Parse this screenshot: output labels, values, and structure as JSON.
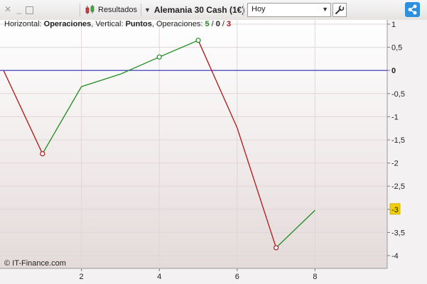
{
  "toolbar": {
    "results_label": "Resultados",
    "instrument_label": "Alemania 30 Cash (1€)",
    "period_value": "Hoy"
  },
  "legend": {
    "horizontal_prefix": "Horizontal: ",
    "horizontal_value": "Operaciones",
    "vertical_prefix": ", Vertical: ",
    "vertical_value": "Puntos",
    "operations_prefix": ", Operaciones: ",
    "wins": "5",
    "neutral": "0",
    "losses": "3",
    "slash": " / "
  },
  "copyright": "© IT-Finance.com",
  "colors": {
    "up": "#1c8a1c",
    "down": "#b01616",
    "zero_line": "#2a2ab8",
    "current_badge": "#f0d000"
  },
  "chart_data": {
    "type": "line",
    "x": [
      0,
      1,
      2,
      3,
      4,
      5,
      6,
      7,
      8
    ],
    "y": [
      0,
      -1.8,
      -0.35,
      -0.08,
      0.29,
      0.65,
      -1.24,
      -3.83,
      -3.02
    ],
    "marked_points": [
      1,
      4,
      5,
      7
    ],
    "xlim": [
      0,
      10
    ],
    "ylim": [
      -4.15,
      1.0
    ],
    "x_ticks": [
      2,
      4,
      6,
      8
    ],
    "y_ticks": [
      {
        "v": 1,
        "label": "1"
      },
      {
        "v": 0.5,
        "label": "0,5"
      },
      {
        "v": 0,
        "label": "0"
      },
      {
        "v": -0.5,
        "label": "-0,5"
      },
      {
        "v": -1,
        "label": "-1"
      },
      {
        "v": -1.5,
        "label": "-1,5"
      },
      {
        "v": -2,
        "label": "-2"
      },
      {
        "v": -2.5,
        "label": "-2,5"
      },
      {
        "v": -3,
        "label": "-3"
      },
      {
        "v": -3.5,
        "label": "-3,5"
      },
      {
        "v": -4,
        "label": "-4"
      }
    ],
    "current_label": "-3",
    "grid": true
  }
}
